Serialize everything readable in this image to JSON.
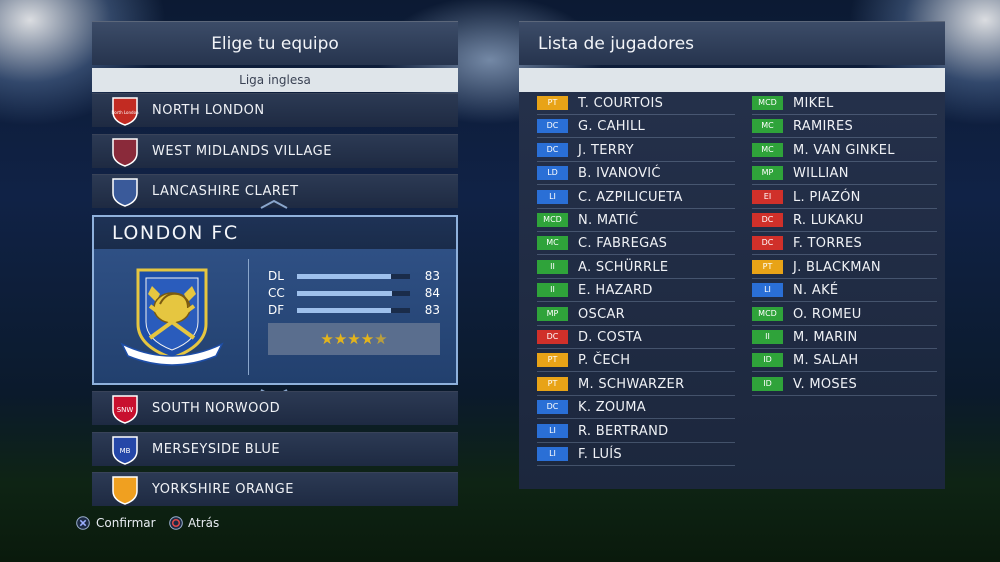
{
  "left_panel": {
    "title": "Elige tu equipo",
    "league": "Liga inglesa",
    "teams_above": [
      {
        "name": "NORTH LONDON",
        "crest_text": "North London",
        "color": "#c22b22"
      },
      {
        "name": "WEST MIDLANDS VILLAGE",
        "color": "#8a2a3a"
      },
      {
        "name": "LANCASHIRE CLARET",
        "color": "#3a5a9a"
      }
    ],
    "selected": {
      "name": "LONDON FC",
      "stats": [
        {
          "label": "DL",
          "value": 83
        },
        {
          "label": "CC",
          "value": 84
        },
        {
          "label": "DF",
          "value": 83
        }
      ],
      "stars_rating": 4.5,
      "stars_max": 5
    },
    "teams_below": [
      {
        "name": "SOUTH NORWOOD",
        "crest_text": "SNW",
        "color": "#c8102e"
      },
      {
        "name": "MERSEYSIDE BLUE",
        "crest_text": "MB",
        "color": "#2547a8"
      },
      {
        "name": "YORKSHIRE ORANGE",
        "color": "#f0a020"
      }
    ]
  },
  "right_panel": {
    "title": "Lista de jugadores",
    "players_col1": [
      {
        "pos": "PT",
        "name": "T. COURTOIS",
        "color": "#e8a317"
      },
      {
        "pos": "DC",
        "name": "G. CAHILL",
        "color": "#2a6fd6"
      },
      {
        "pos": "DC",
        "name": "J. TERRY",
        "color": "#2a6fd6"
      },
      {
        "pos": "LD",
        "name": "B. IVANOVIĆ",
        "color": "#2a6fd6"
      },
      {
        "pos": "LI",
        "name": "C. AZPILICUETA",
        "color": "#2a6fd6"
      },
      {
        "pos": "MCD",
        "name": "N. MATIĆ",
        "color": "#2fa33a"
      },
      {
        "pos": "MC",
        "name": "C. FABREGAS",
        "color": "#2fa33a"
      },
      {
        "pos": "II",
        "name": "A. SCHÜRRLE",
        "color": "#2fa33a"
      },
      {
        "pos": "II",
        "name": "E. HAZARD",
        "color": "#2fa33a"
      },
      {
        "pos": "MP",
        "name": "OSCAR",
        "color": "#2fa33a"
      },
      {
        "pos": "DC",
        "name": "D. COSTA",
        "color": "#d0302a"
      },
      {
        "pos": "PT",
        "name": "P. ČECH",
        "color": "#e8a317"
      },
      {
        "pos": "PT",
        "name": "M. SCHWARZER",
        "color": "#e8a317"
      },
      {
        "pos": "DC",
        "name": "K. ZOUMA",
        "color": "#2a6fd6"
      },
      {
        "pos": "LI",
        "name": "R. BERTRAND",
        "color": "#2a6fd6"
      },
      {
        "pos": "LI",
        "name": "F. LUÍS",
        "color": "#2a6fd6"
      }
    ],
    "players_col2": [
      {
        "pos": "MCD",
        "name": "MIKEL",
        "color": "#2fa33a"
      },
      {
        "pos": "MC",
        "name": "RAMIRES",
        "color": "#2fa33a"
      },
      {
        "pos": "MC",
        "name": "M. VAN GINKEL",
        "color": "#2fa33a"
      },
      {
        "pos": "MP",
        "name": "WILLIAN",
        "color": "#2fa33a"
      },
      {
        "pos": "EI",
        "name": "L. PIAZÓN",
        "color": "#d0302a"
      },
      {
        "pos": "DC",
        "name": "R. LUKAKU",
        "color": "#d0302a"
      },
      {
        "pos": "DC",
        "name": "F. TORRES",
        "color": "#d0302a"
      },
      {
        "pos": "PT",
        "name": "J. BLACKMAN",
        "color": "#e8a317"
      },
      {
        "pos": "LI",
        "name": "N. AKÉ",
        "color": "#2a6fd6"
      },
      {
        "pos": "MCD",
        "name": "O. ROMEU",
        "color": "#2fa33a"
      },
      {
        "pos": "II",
        "name": "M. MARIN",
        "color": "#2fa33a"
      },
      {
        "pos": "ID",
        "name": "M. SALAH",
        "color": "#2fa33a"
      },
      {
        "pos": "ID",
        "name": "V. MOSES",
        "color": "#2fa33a"
      }
    ]
  },
  "footer": {
    "confirm_label": "Confirmar",
    "back_label": "Atrás",
    "confirm_icon": "cross-button-icon",
    "back_icon": "circle-button-icon"
  }
}
